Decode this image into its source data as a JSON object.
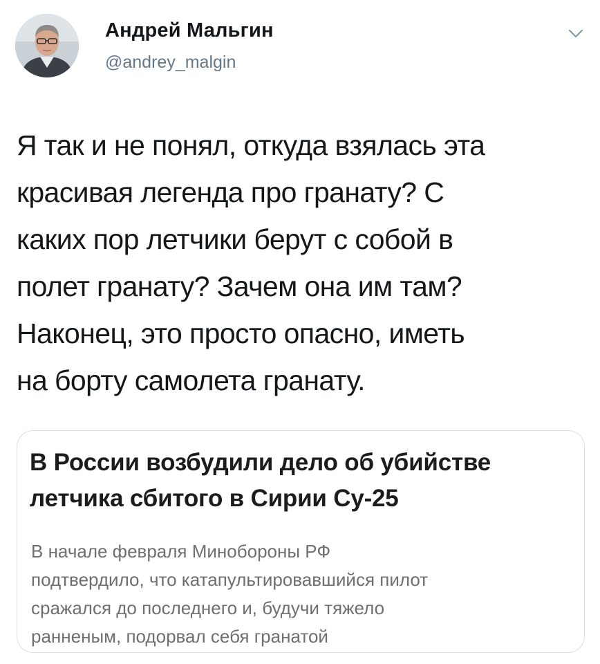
{
  "author": {
    "display_name": "Андрей Мальгин",
    "handle": "@andrey_malgin",
    "avatar_icon": "user-photo-icon"
  },
  "menu": {
    "icon": "chevron-down-icon"
  },
  "tweet": {
    "lines": [
      "Я так и не понял, откуда взялась эта",
      "красивая легенда про гранату? С",
      "каких пор летчики берут с собой в",
      "полет гранату? Зачем она им там?",
      "Наконец, это просто опасно, иметь",
      "на борту самолета гранату."
    ]
  },
  "card": {
    "title_lines": [
      "В России возбудили дело об убийстве",
      "летчика сбитого в Сирии Су-25"
    ],
    "description_lines": [
      "В начале февраля Минобороны РФ",
      "подтвердило, что катапультировавшийся пилот",
      "сражался до последнего и, будучи тяжело",
      "ранненым, подорвал себя гранатой"
    ]
  },
  "colors": {
    "text": "#14171a",
    "secondary": "#657786",
    "card_border": "#dcdfe2"
  }
}
